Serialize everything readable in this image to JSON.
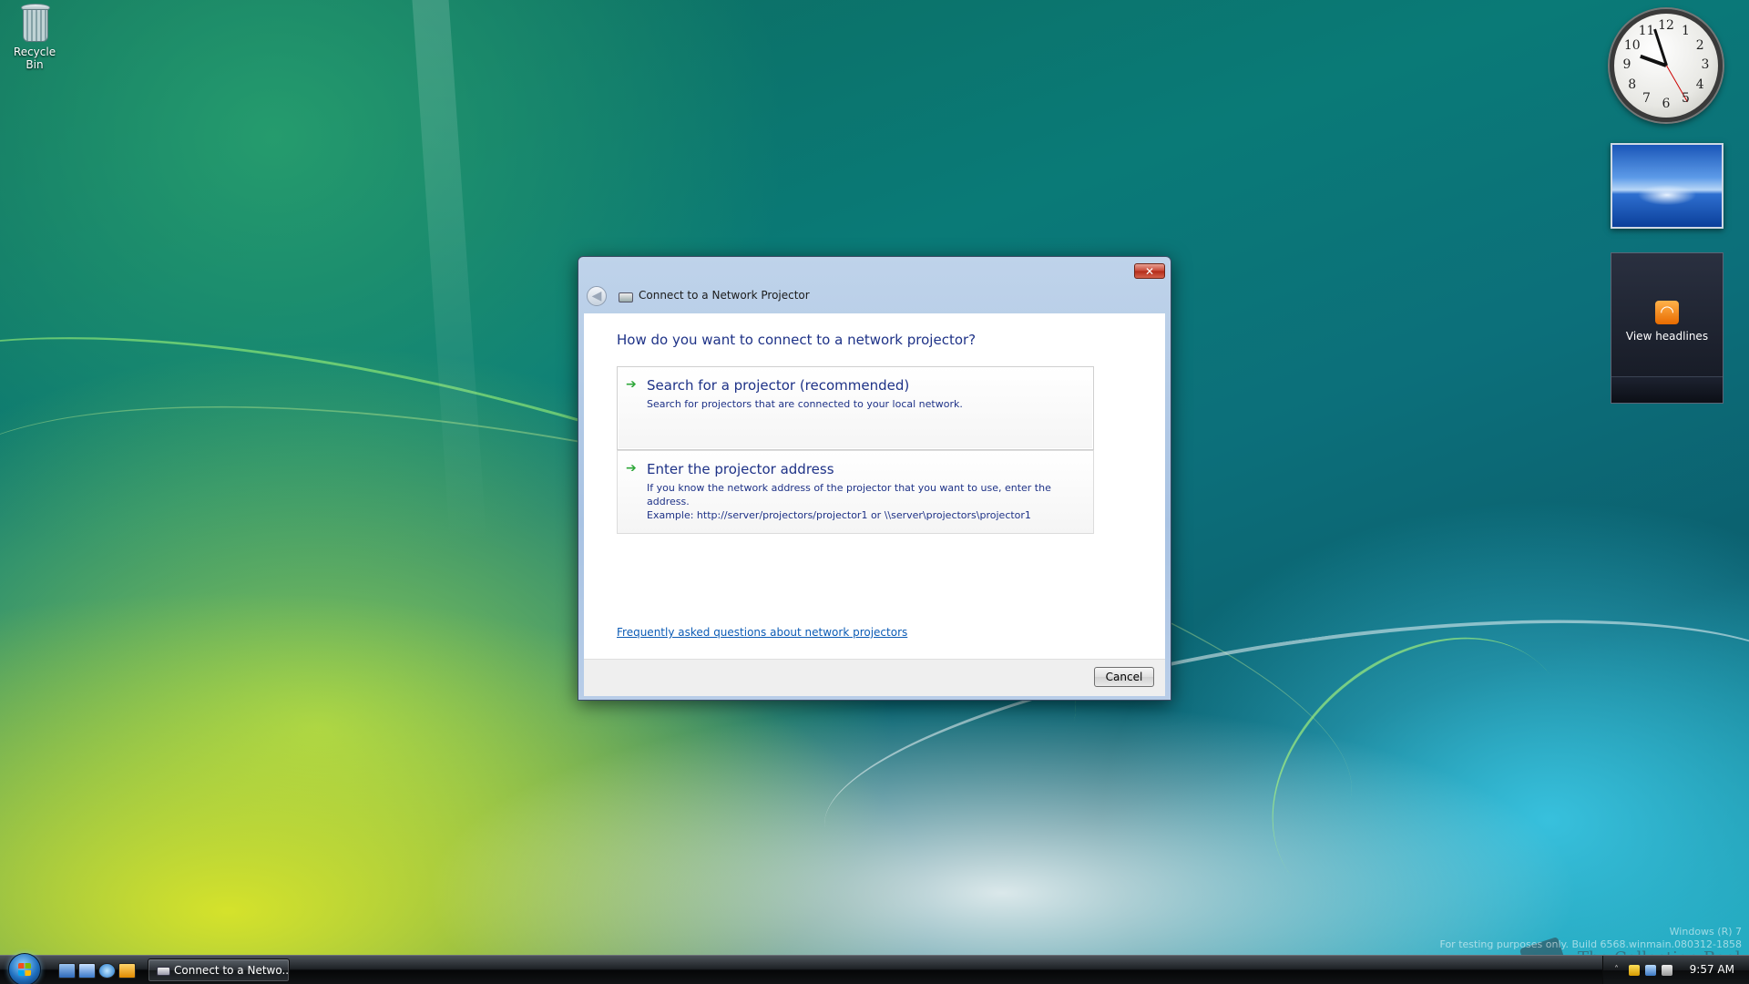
{
  "desktop": {
    "recycle_bin_label": "Recycle Bin"
  },
  "gadgets": {
    "clock_numbers": [
      "12",
      "1",
      "2",
      "3",
      "4",
      "5",
      "6",
      "7",
      "8",
      "9",
      "10",
      "11"
    ],
    "feed_label": "View headlines",
    "feed_icon": "rss-icon"
  },
  "dialog": {
    "title": "Connect to a Network Projector",
    "close_label": "✕",
    "back_label": "◀",
    "heading": "How do you want to connect to a network projector?",
    "options": [
      {
        "title": "Search for a projector (recommended)",
        "description": "Search for projectors that are connected to your local network."
      },
      {
        "title": "Enter the projector address",
        "description": "If you know the network address of the projector that you want to use, enter the address.",
        "example": "Example: http://server/projectors/projector1 or \\\\server\\projectors\\projector1"
      }
    ],
    "faq_link": "Frequently asked questions about network projectors",
    "cancel_label": "Cancel"
  },
  "watermark": {
    "line1": "Windows (R) 7",
    "line2": "For testing purposes only. Build 6568.winmain.080312-1858",
    "brand": "The Collection Book"
  },
  "taskbar": {
    "task_button_label": "Connect to a Netwo...",
    "clock_time": "9:57 AM",
    "quick_launch": [
      "show-desktop-icon",
      "switch-windows-icon",
      "internet-explorer-icon",
      "media-player-icon"
    ]
  },
  "colors": {
    "accent_text": "#1e3287",
    "link": "#0b5bb5",
    "arrow_green": "#2fa83a"
  }
}
